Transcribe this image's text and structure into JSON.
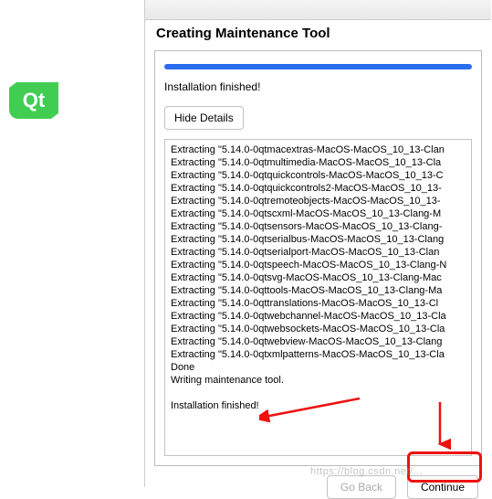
{
  "logo_text": "Qt",
  "title": "Creating Maintenance Tool",
  "status": "Installation finished!",
  "hide_details_label": "Hide Details",
  "log_lines": [
    "Extracting \"5.14.0-0qtmacextras-MacOS-MacOS_10_13-Clan",
    "Extracting \"5.14.0-0qtmultimedia-MacOS-MacOS_10_13-Cla",
    "Extracting \"5.14.0-0qtquickcontrols-MacOS-MacOS_10_13-C",
    "Extracting \"5.14.0-0qtquickcontrols2-MacOS-MacOS_10_13-",
    "Extracting \"5.14.0-0qtremoteobjects-MacOS-MacOS_10_13-",
    "Extracting \"5.14.0-0qtscxml-MacOS-MacOS_10_13-Clang-M",
    "Extracting \"5.14.0-0qtsensors-MacOS-MacOS_10_13-Clang-",
    "Extracting \"5.14.0-0qtserialbus-MacOS-MacOS_10_13-Clang",
    "Extracting \"5.14.0-0qtserialport-MacOS-MacOS_10_13-Clan",
    "Extracting \"5.14.0-0qtspeech-MacOS-MacOS_10_13-Clang-N",
    "Extracting \"5.14.0-0qtsvg-MacOS-MacOS_10_13-Clang-Mac",
    "Extracting \"5.14.0-0qttools-MacOS-MacOS_10_13-Clang-Ma",
    "Extracting \"5.14.0-0qttranslations-MacOS-MacOS_10_13-Cl",
    "Extracting \"5.14.0-0qtwebchannel-MacOS-MacOS_10_13-Cla",
    "Extracting \"5.14.0-0qtwebsockets-MacOS-MacOS_10_13-Cla",
    "Extracting \"5.14.0-0qtwebview-MacOS-MacOS_10_13-Clang",
    "Extracting \"5.14.0-0qtxmlpatterns-MacOS-MacOS_10_13-Cla",
    "Done",
    "Writing maintenance tool.",
    "",
    "Installation finished!"
  ],
  "buttons": {
    "go_back": "Go Back",
    "continue": "Continue"
  },
  "watermark": "https://blog.csdn.net/..."
}
